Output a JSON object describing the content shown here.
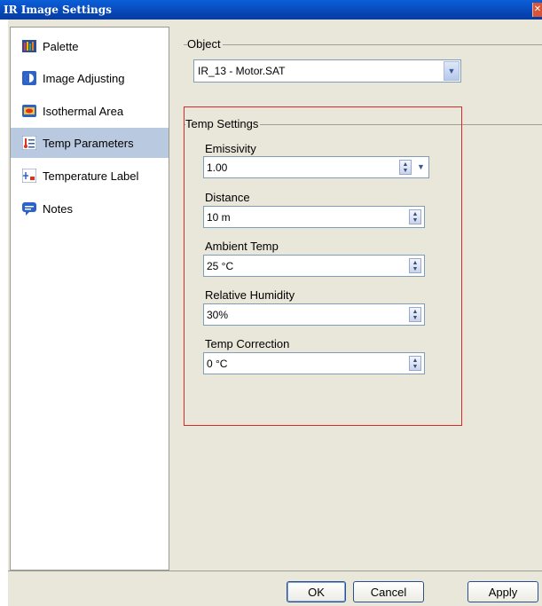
{
  "window": {
    "title": "IR Image Settings",
    "close_label": "✕"
  },
  "nav": {
    "items": [
      {
        "label": "Palette",
        "icon": "palette-icon"
      },
      {
        "label": "Image Adjusting",
        "icon": "image-adjusting-icon"
      },
      {
        "label": "Isothermal Area",
        "icon": "isothermal-area-icon"
      },
      {
        "label": "Temp Parameters",
        "icon": "temp-parameters-icon"
      },
      {
        "label": "Temperature Label",
        "icon": "temperature-label-icon"
      },
      {
        "label": "Notes",
        "icon": "notes-icon"
      }
    ],
    "selected": "Temp Parameters"
  },
  "object": {
    "group_label": "Object",
    "selected_value": "IR_13 - Motor.SAT"
  },
  "temp_settings": {
    "group_label": "Temp Settings",
    "emissivity": {
      "label": "Emissivity",
      "value": "1.00"
    },
    "distance": {
      "label": "Distance",
      "value": "10 m"
    },
    "ambient_temp": {
      "label": "Ambient Temp",
      "value": "25 °C"
    },
    "relative_humidity": {
      "label": "Relative Humidity",
      "value": "30%"
    },
    "temp_correction": {
      "label": "Temp Correction",
      "value": "0 °C"
    }
  },
  "buttons": {
    "ok": "OK",
    "cancel": "Cancel",
    "apply": "Apply"
  },
  "colors": {
    "title_bar": "#0747b8",
    "selection": "#b9c9df",
    "highlight_box": "#d92b2b"
  }
}
